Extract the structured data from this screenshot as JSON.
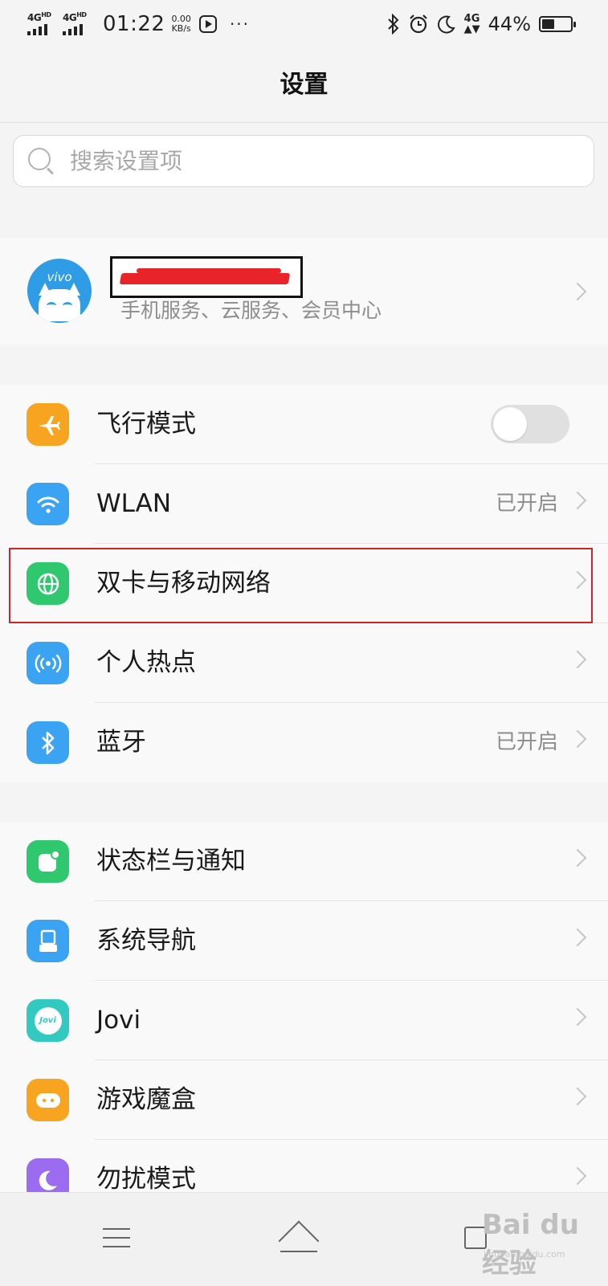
{
  "status_bar": {
    "sim1_label": "4G",
    "sim1_sup": "HD",
    "sim2_label": "4G",
    "sim2_sup": "HD",
    "time": "01:22",
    "speed_value": "0.00",
    "speed_unit": "KB/s",
    "more_dots": "···",
    "network_label": "4G",
    "battery_percent": "44%",
    "battery_level": 0.44
  },
  "header": {
    "title": "设置"
  },
  "search": {
    "placeholder": "搜索设置项"
  },
  "account": {
    "brand": "vivo",
    "subtitle": "手机服务、云服务、会员中心"
  },
  "group1": [
    {
      "label": "飞行模式",
      "icon": "airplane-icon",
      "color": "#f7a521",
      "control": "toggle",
      "toggle_on": false
    },
    {
      "label": "WLAN",
      "icon": "wifi-icon",
      "color": "#3aa3f2",
      "value": "已开启"
    },
    {
      "label": "双卡与移动网络",
      "icon": "globe-icon",
      "color": "#2fc86f",
      "highlighted": true
    },
    {
      "label": "个人热点",
      "icon": "hotspot-icon",
      "color": "#3aa3f2"
    },
    {
      "label": "蓝牙",
      "icon": "bluetooth-icon",
      "color": "#3aa3f2",
      "value": "已开启"
    }
  ],
  "group2": [
    {
      "label": "状态栏与通知",
      "icon": "notification-icon",
      "color": "#2fc86f"
    },
    {
      "label": "系统导航",
      "icon": "navigation-icon",
      "color": "#3aa3f2"
    },
    {
      "label": "Jovi",
      "icon": "jovi-icon",
      "color": "#32c9c0",
      "icon_text": "Jovi"
    },
    {
      "label": "游戏魔盒",
      "icon": "game-box-icon",
      "color": "#f7a521"
    },
    {
      "label": "勿扰模式",
      "icon": "moon-icon",
      "color": "#9b6cf0"
    }
  ],
  "watermark": {
    "text": "Bai du 经验",
    "sub": "jingyan.baidu.com"
  }
}
